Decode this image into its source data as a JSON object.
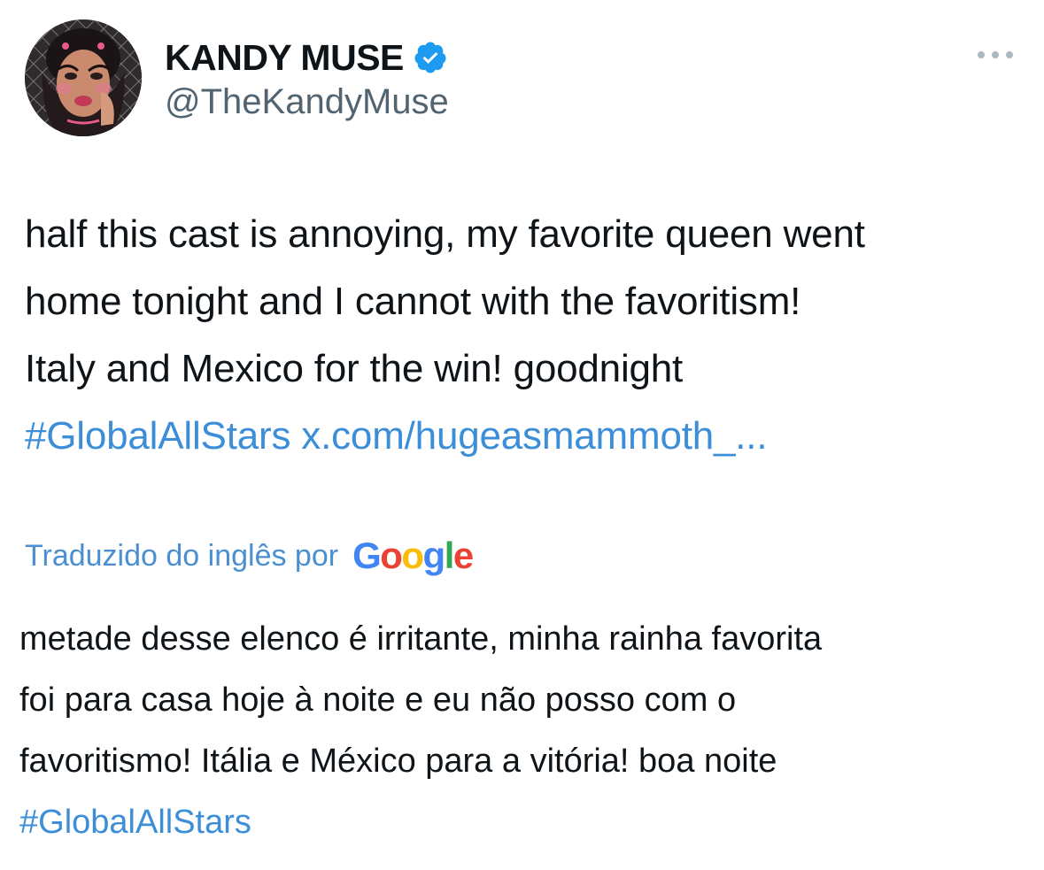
{
  "user": {
    "display_name": "KANDY MUSE",
    "handle": "@TheKandyMuse",
    "verified": true,
    "avatar_icon": "profile-photo"
  },
  "header": {
    "more_icon": "more-horizontal-icon"
  },
  "tweet": {
    "lines": [
      "half this cast is annoying, my favorite queen went",
      "home tonight and I cannot with the favoritism!",
      "Italy and Mexico for the win! goodnight"
    ],
    "hashtag": "#GlobalAllStars",
    "link": "x.com/hugeasmammoth_..."
  },
  "translation": {
    "label": "Traduzido do inglês por",
    "provider": "Google",
    "lines": [
      "metade desse elenco é irritante, minha rainha favorita",
      "foi para casa hoje à noite e eu não posso com o",
      "favoritismo! Itália e México para a vitória! boa noite"
    ],
    "hashtag": "#GlobalAllStars"
  },
  "colors": {
    "link": "#3d8ed8",
    "verified": "#1d9bf0",
    "secondary_text": "#536471",
    "google_blue": "#4285F4",
    "google_red": "#EA4335",
    "google_yellow": "#FBBC05",
    "google_green": "#34A853"
  }
}
